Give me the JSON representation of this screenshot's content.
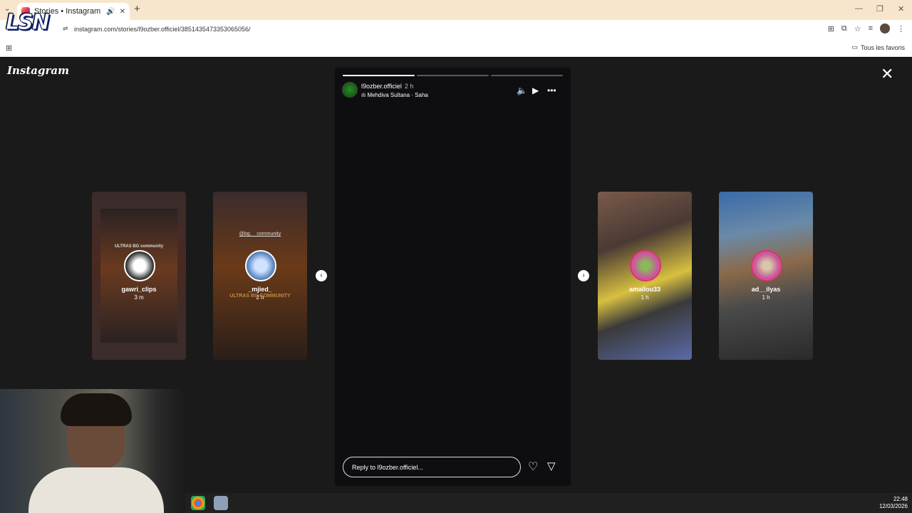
{
  "browser": {
    "tab_title": "Stories • Instagram",
    "url": "instagram.com/stories/l9ozber.officiel/3851435473353065056/",
    "bookmark_folder": "Tous les favoris"
  },
  "overlay_logo": "LSN",
  "page": {
    "logo": "Instagram"
  },
  "story": {
    "username": "l9ozber.officiel",
    "time": "2 h",
    "music": "Mehdiva Sultana · Saha",
    "progress": [
      1.0,
      0.0,
      0.0
    ],
    "reply_placeholder": "Reply to l9ozber.officiel..."
  },
  "side_stories": [
    {
      "name": "gawri_clips",
      "time": "3 m",
      "caption": "ULTRAS BG community",
      "tag": ""
    },
    {
      "name": "_mjied_",
      "time": "2 h",
      "caption": "ULTRAS BG COMMUNITY",
      "tag": "@bg.__community"
    },
    {
      "name": "amallou33",
      "time": "1 h",
      "caption": "",
      "tag": ""
    },
    {
      "name": "ad__ilyas",
      "time": "1 h",
      "caption": "",
      "tag": ""
    }
  ],
  "clock": {
    "time": "22:48",
    "date": "12/03/2026"
  },
  "colors": {
    "tabbar": "#f8e6cc",
    "page_bg": "#1a1a1a",
    "story_bg": "#0e0e11"
  }
}
